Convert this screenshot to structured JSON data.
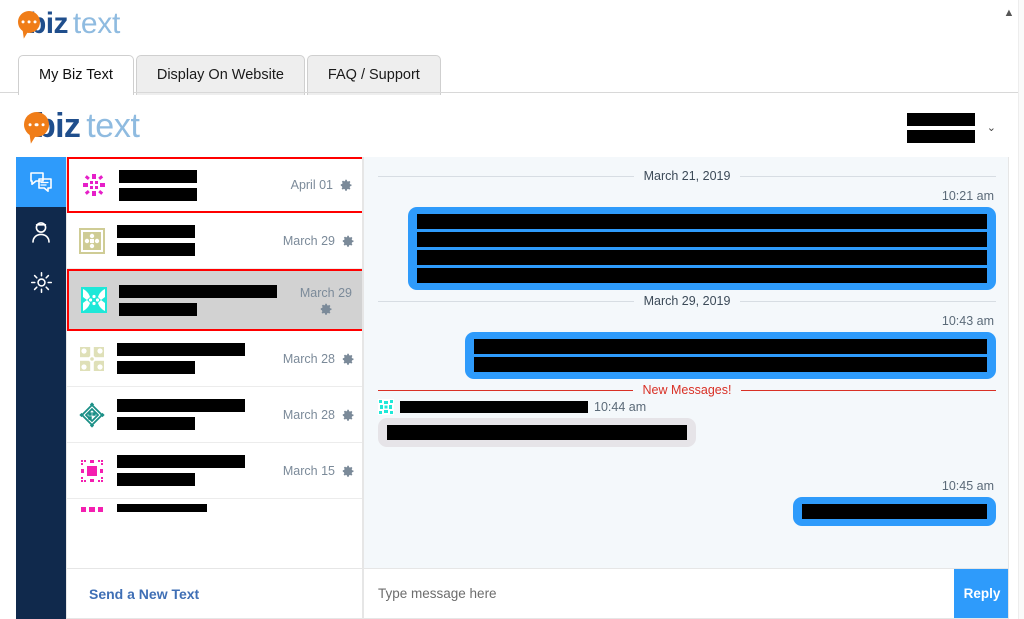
{
  "brand": {
    "part1": "biz",
    "part2": "text",
    "orange": "#f07d18",
    "navy": "#1f4e8c",
    "lightblue": "#8fbbe0"
  },
  "top_nav": {
    "tabs": [
      {
        "label": "My Biz Text",
        "active": true
      },
      {
        "label": "Display On Website",
        "active": false
      },
      {
        "label": "FAQ / Support",
        "active": false
      }
    ]
  },
  "scroll_arrow": "▲",
  "account": {
    "caret": "⌄",
    "name_redacted": true
  },
  "rail": {
    "items": [
      {
        "name": "messages",
        "icon": "chat-bubbles-icon",
        "active": true
      },
      {
        "name": "contacts",
        "icon": "person-icon",
        "active": false
      },
      {
        "name": "settings",
        "icon": "gear-icon",
        "active": false
      }
    ],
    "background": "#10294c",
    "active_background": "#2e9bfb"
  },
  "conversations": {
    "items": [
      {
        "date": "April 01",
        "avatar": "identicon-magenta-star",
        "selected": false,
        "outlined": true,
        "stacked_meta": false,
        "name_width": 78,
        "preview_width": 78
      },
      {
        "date": "March 29",
        "avatar": "identicon-olive-square",
        "selected": false,
        "outlined": false,
        "stacked_meta": false,
        "name_width": 78,
        "preview_width": 78
      },
      {
        "date": "March 29",
        "avatar": "identicon-cyan-burst",
        "selected": true,
        "outlined": true,
        "stacked_meta": true,
        "name_width": 158,
        "preview_width": 78
      },
      {
        "date": "March 28",
        "avatar": "identicon-pale-olive",
        "selected": false,
        "outlined": false,
        "stacked_meta": false,
        "name_width": 128,
        "preview_width": 78
      },
      {
        "date": "March 28",
        "avatar": "identicon-teal-diamond",
        "selected": false,
        "outlined": false,
        "stacked_meta": false,
        "name_width": 128,
        "preview_width": 78
      },
      {
        "date": "March 15",
        "avatar": "identicon-magenta-square",
        "selected": false,
        "outlined": false,
        "stacked_meta": false,
        "name_width": 128,
        "preview_width": 78
      }
    ],
    "partial_item": {
      "avatar": "identicon-pink-partial"
    },
    "footer_link": "Send a New Text"
  },
  "thread": {
    "blocks": [
      {
        "kind": "divider",
        "label": "March 21, 2019"
      },
      {
        "kind": "time",
        "label": "10:21 am",
        "align": "right"
      },
      {
        "kind": "bubble",
        "direction": "out",
        "line_widths": [
          570,
          570,
          570,
          570
        ]
      },
      {
        "kind": "divider",
        "label": "March 29, 2019"
      },
      {
        "kind": "time",
        "label": "10:43 am",
        "align": "right"
      },
      {
        "kind": "bubble",
        "direction": "out",
        "line_widths": [
          513,
          513
        ]
      },
      {
        "kind": "divider",
        "label": "New Messages!",
        "alert": true
      },
      {
        "kind": "inbound_head",
        "time": "10:44 am",
        "name_width": 188,
        "avatar": "identicon-cyan-small"
      },
      {
        "kind": "bubble",
        "direction": "in",
        "line_widths": [
          300
        ]
      },
      {
        "kind": "time",
        "label": "10:45 am",
        "align": "right"
      },
      {
        "kind": "bubble",
        "direction": "out",
        "line_widths": [
          185
        ]
      }
    ]
  },
  "composer": {
    "placeholder": "Type message here",
    "value": "",
    "reply_label": "Reply"
  },
  "colors": {
    "accent_blue": "#2e9bfb",
    "alert_red": "#d93025",
    "outline_red": "#ff0000",
    "panel_bg": "#f4f8fb"
  }
}
